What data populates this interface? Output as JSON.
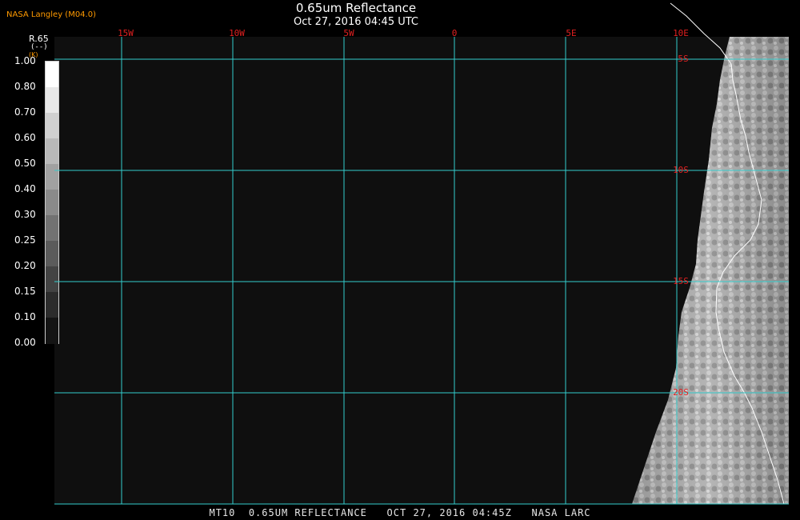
{
  "header": {
    "title": "0.65um Reflectance",
    "timestamp": "Oct 27, 2016 04:45 UTC",
    "credit": "NASA Langley (M04.0)"
  },
  "colorbar": {
    "name": "R.65",
    "unit": "(--)",
    "unit_note": "(K)",
    "labels": [
      "1.00",
      "0.80",
      "0.70",
      "0.60",
      "0.50",
      "0.40",
      "0.30",
      "0.25",
      "0.20",
      "0.15",
      "0.10",
      "0.00"
    ]
  },
  "grid": {
    "longitudes": [
      "15W",
      "10W",
      "5W",
      "0",
      "5E",
      "10E"
    ],
    "latitudes": [
      "5S",
      "10S",
      "15S",
      "20S"
    ]
  },
  "footer": "MT10  0.65UM REFLECTANCE   OCT 27, 2016 04:45Z   NASA LARC",
  "colors": {
    "grid_line": "#33cccc",
    "grid_label": "#e02020",
    "credit": "#ff9a00",
    "background": "#0f0f0f",
    "coastline": "#ffffff"
  }
}
